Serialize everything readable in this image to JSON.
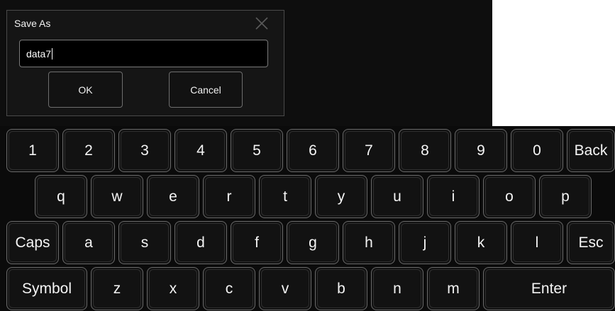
{
  "dialog": {
    "title": "Save As",
    "filename_value": "data7",
    "close_icon": "close-icon",
    "ok_label": "OK",
    "cancel_label": "Cancel"
  },
  "keyboard": {
    "rows": [
      [
        "1",
        "2",
        "3",
        "4",
        "5",
        "6",
        "7",
        "8",
        "9",
        "0",
        "Back"
      ],
      [
        "q",
        "w",
        "e",
        "r",
        "t",
        "y",
        "u",
        "i",
        "o",
        "p"
      ],
      [
        "Caps",
        "a",
        "s",
        "d",
        "f",
        "g",
        "h",
        "j",
        "k",
        "l",
        "Esc"
      ],
      [
        "Symbol",
        "z",
        "x",
        "c",
        "v",
        "b",
        "n",
        "m",
        "Enter"
      ]
    ]
  },
  "colors": {
    "background": "#0e0e0e",
    "key_border": "#6a6a6a",
    "text": "#f4f4f4"
  }
}
